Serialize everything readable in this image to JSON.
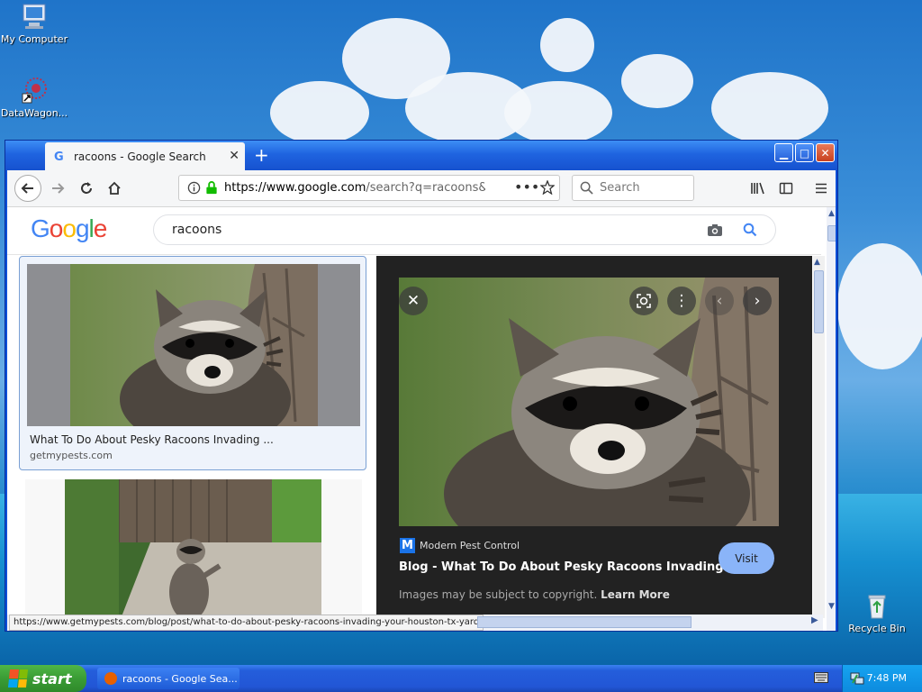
{
  "desktop": {
    "icons": [
      {
        "label": "My Computer"
      },
      {
        "label": "DataWagon..."
      },
      {
        "label": "Recycle Bin"
      }
    ]
  },
  "browser": {
    "tab_title": "racoons - Google Search",
    "url": {
      "host": "https://www.google.com",
      "rest": "/search?q=racoons&saf"
    },
    "search_placeholder": "Search"
  },
  "google": {
    "logo": "Google",
    "query": "racoons"
  },
  "results": [
    {
      "title": "What To Do About Pesky Racoons Invading ...",
      "source": "getmypests.com"
    }
  ],
  "preview": {
    "site": "Modern Pest Control",
    "site_logo": "M",
    "title": "Blog - What To Do About Pesky Racoons Invading...",
    "visit_label": "Visit",
    "copyright": "Images may be subject to copyright.",
    "learn_more": "Learn More"
  },
  "status_url": "https://www.getmypests.com/blog/post/what-to-do-about-pesky-racoons-invading-your-houston-tx-yard",
  "taskbar": {
    "start_label": "start",
    "task_label": "racoons - Google Sea...",
    "clock": "7:48 PM"
  },
  "colors": {
    "xp_blue": "#245edb",
    "start_green": "#3a9c35",
    "google_blue": "#4285f4",
    "visit_blue": "#8ab4f8"
  }
}
